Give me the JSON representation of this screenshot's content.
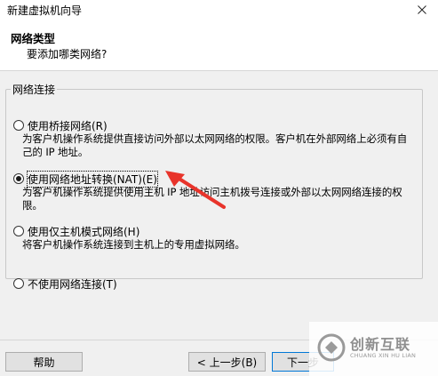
{
  "window": {
    "title": "新建虚拟机向导"
  },
  "header": {
    "title": "网络类型",
    "subtitle": "要添加哪类网络?"
  },
  "group": {
    "label": "网络连接"
  },
  "options": [
    {
      "label": "使用桥接网络(R)",
      "description": "为客户机操作系统提供直接访问外部以太网网络的权限。客户机在外部网络上必须有自己的 IP 地址。",
      "selected": false
    },
    {
      "label": "使用网络地址转换(NAT)(E)",
      "description": "为客户机操作系统提供使用主机 IP 地址访问主机拨号连接或外部以太网网络连接的权限。",
      "selected": true
    },
    {
      "label": "使用仅主机模式网络(H)",
      "description": "将客户机操作系统连接到主机上的专用虚拟网络。",
      "selected": false
    },
    {
      "label": "不使用网络连接(T)",
      "description": "",
      "selected": false
    }
  ],
  "buttons": {
    "help": "帮助",
    "back": "< 上一步(B)",
    "next": "下一步"
  },
  "watermark": {
    "name": "创新互联",
    "subtitle": "CHUANG XIN HU LIAN"
  },
  "colors": {
    "annotation_arrow": "#e8342b"
  }
}
